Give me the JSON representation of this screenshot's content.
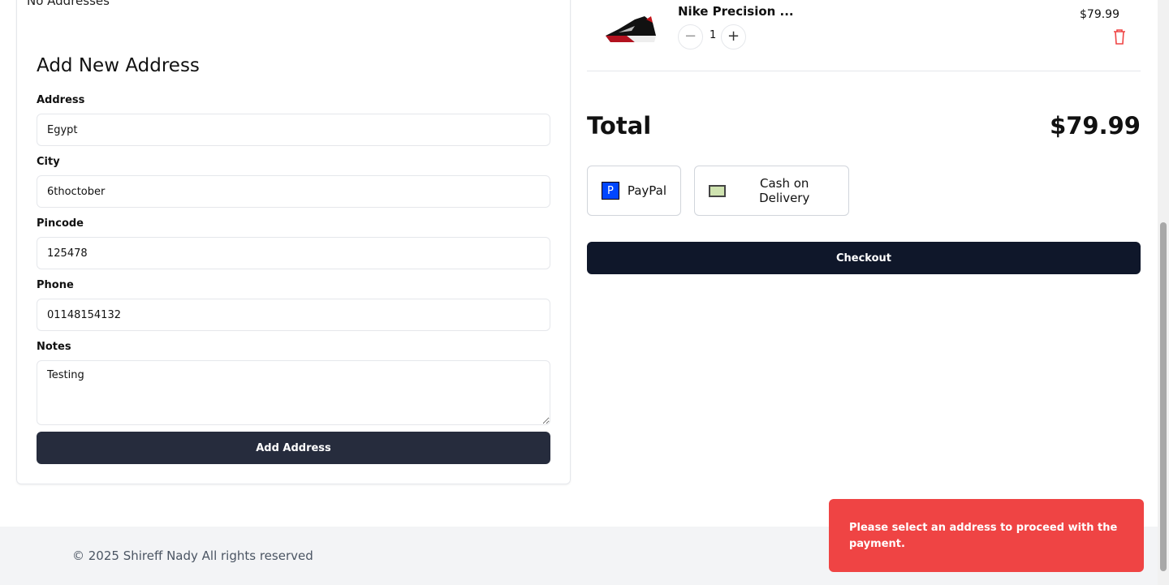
{
  "address_section": {
    "no_addresses": "No Addresses",
    "title": "Add New Address",
    "fields": [
      {
        "label": "Address",
        "value": "Egypt"
      },
      {
        "label": "City",
        "value": "6thoctober"
      },
      {
        "label": "Pincode",
        "value": "125478"
      },
      {
        "label": "Phone",
        "value": "01148154132"
      },
      {
        "label": "Notes",
        "value": "Testing"
      }
    ],
    "add_button": "Add Address"
  },
  "cart": {
    "item": {
      "name": "Nike Precision ...",
      "quantity": "1",
      "price": "$79.99",
      "minus": "−",
      "plus": "+"
    },
    "total_label": "Total",
    "total_value": "$79.99",
    "payment_methods": [
      {
        "label": "PayPal",
        "icon": "paypal-icon"
      },
      {
        "label": "Cash on Delivery",
        "icon": "cash-icon"
      }
    ],
    "checkout": "Checkout"
  },
  "footer": {
    "copyright": "© 2025 Shireff Nady All rights reserved"
  },
  "toast": {
    "message": "Please select an address to proceed with the payment.",
    "color": "#ef4444"
  }
}
